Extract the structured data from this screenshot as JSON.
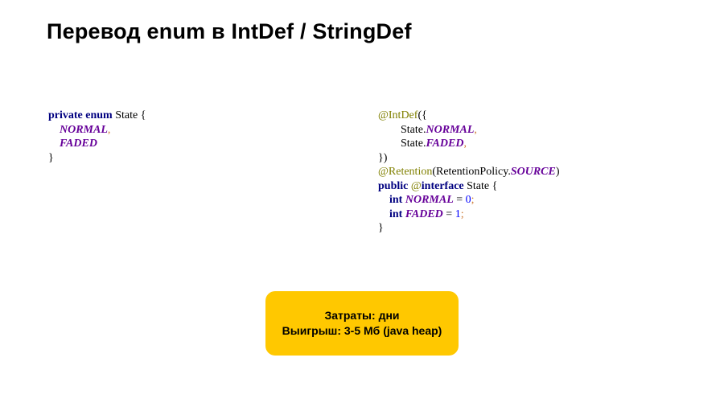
{
  "title": "Перевод  enum в IntDef / StringDef",
  "code_left": {
    "l1_kw1": "private enum",
    "l1_cls": " State ",
    "l1_brace": "{",
    "l2_indent": "    ",
    "l2_enum": "NORMAL",
    "l2_comma": ",",
    "l3_indent": "    ",
    "l3_enum": "FADED",
    "l4_brace": "}"
  },
  "code_right": {
    "r1_ann": "@IntDef",
    "r1_open": "({",
    "r2_indent": "        ",
    "r2_cls": "State",
    "r2_dot": ".",
    "r2_enum": "NORMAL",
    "r2_comma": ",",
    "r3_indent": "        ",
    "r3_cls": "State",
    "r3_dot": ".",
    "r3_enum": "FADED",
    "r3_comma": ",",
    "r4_close": "})",
    "r5_ann": "@Retention",
    "r5_open": "(",
    "r5_cls": "RetentionPolicy",
    "r5_dot": ".",
    "r5_enum": "SOURCE",
    "r5_close": ")",
    "r6_kw1": "public",
    "r6_sp1": " ",
    "r6_at": "@",
    "r6_kw2": "interface",
    "r6_sp2": " ",
    "r6_cls": "State ",
    "r6_brace": "{",
    "r7_indent": "    ",
    "r7_kw": "int",
    "r7_sp": " ",
    "r7_enum": "NORMAL",
    "r7_eq": " = ",
    "r7_num": "0",
    "r7_semi": ";",
    "r8_indent": "    ",
    "r8_kw": "int",
    "r8_sp": " ",
    "r8_enum": "FADED",
    "r8_eq": " = ",
    "r8_num": "1",
    "r8_semi": ";",
    "r9_brace": "}"
  },
  "callout": {
    "line1": "Затраты: дни",
    "line2": "Выигрыш: 3-5 Мб (java heap)"
  }
}
